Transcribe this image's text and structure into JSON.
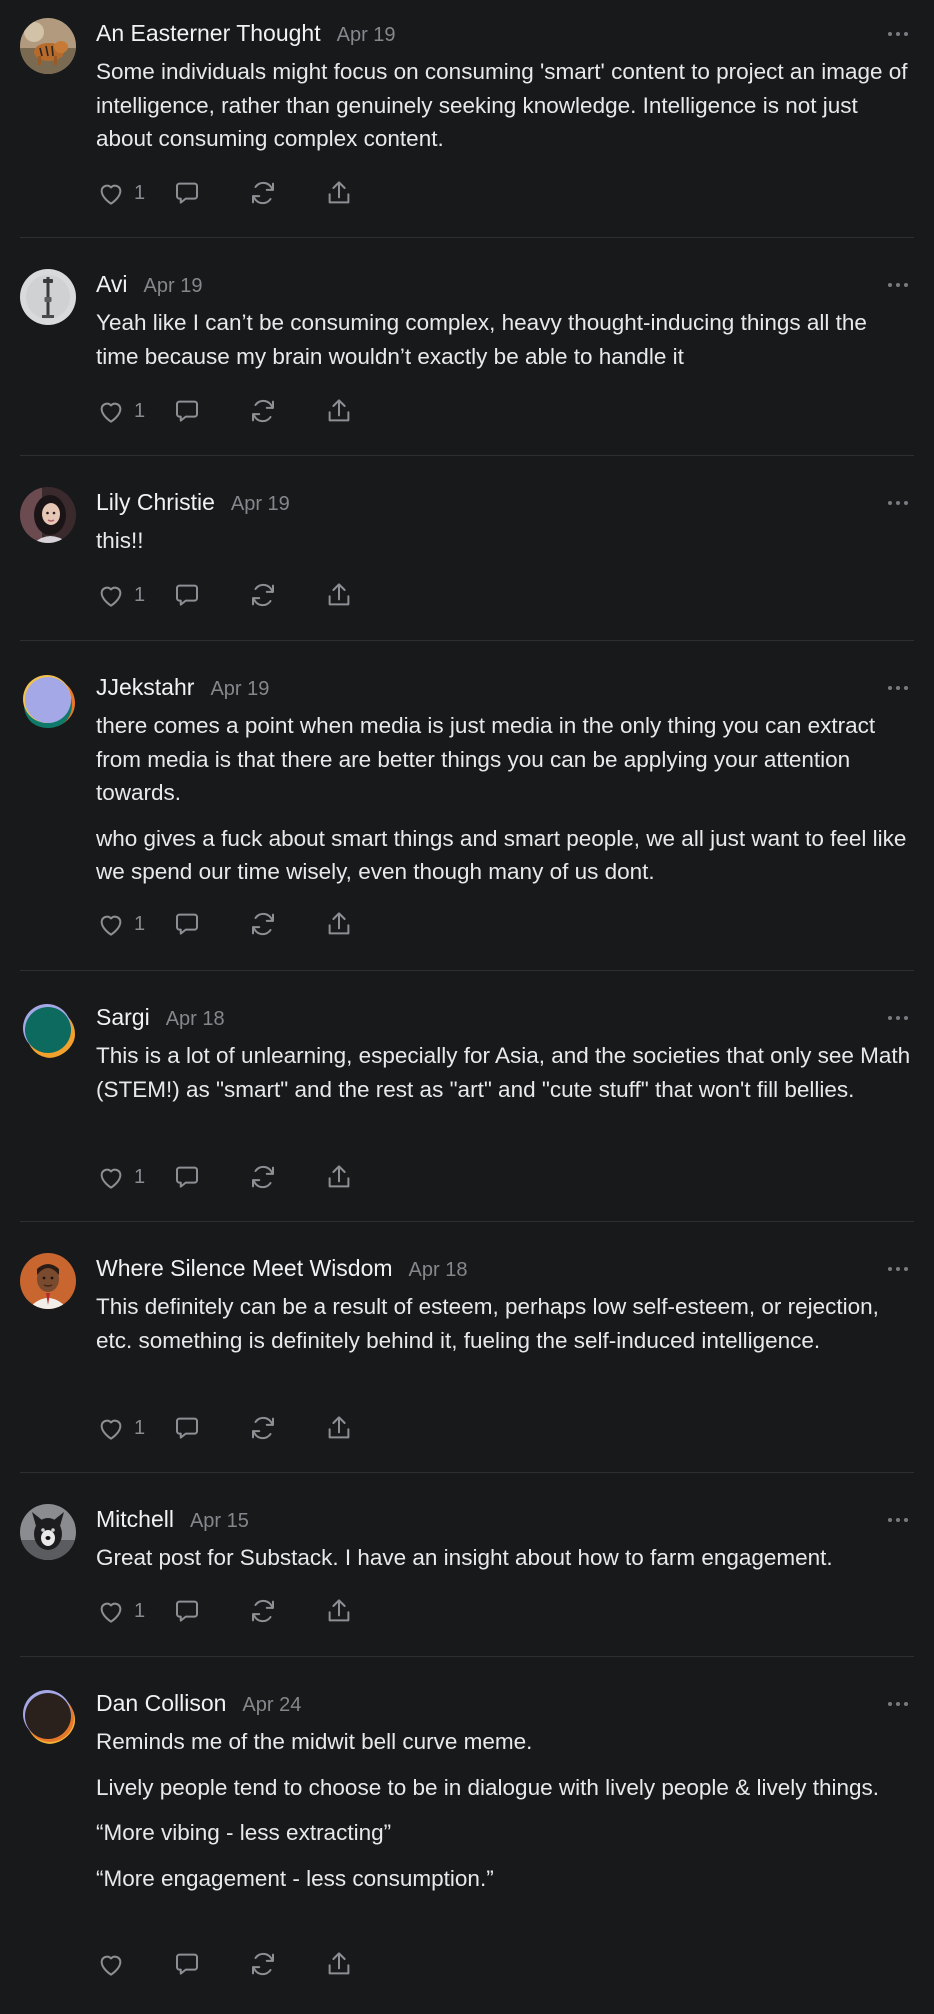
{
  "comments": [
    {
      "author": "An Easterner Thought",
      "date": "Apr 19",
      "paragraphs": [
        "Some individuals might focus on consuming 'smart' content to project an image of intelligence, rather than genuinely seeking knowledge. Intelligence is not just about consuming complex content."
      ],
      "likes": "1",
      "avatar": "photo-tiger"
    },
    {
      "author": "Avi",
      "date": "Apr 19",
      "paragraphs": [
        "Yeah like I can’t be consuming complex, heavy thought-inducing things all the time because my brain wouldn’t exactly be able to handle it"
      ],
      "likes": "1",
      "avatar": "photo-pole"
    },
    {
      "author": "Lily Christie",
      "date": "Apr 19",
      "paragraphs": [
        "this!!"
      ],
      "likes": "1",
      "avatar": "photo-person"
    },
    {
      "author": "JJekstahr",
      "date": "Apr 19",
      "paragraphs": [
        "there comes a point when media is just media in the only thing you can extract from media is that there are better things you can be applying your attention towards.",
        "who gives a fuck about smart things and smart people, we all just want to feel like we spend our time wisely, even though many of us dont."
      ],
      "likes": "1",
      "avatar": "default-lavender"
    },
    {
      "author": "Sargi",
      "date": "Apr 18",
      "paragraphs": [
        "This is a lot of unlearning, especially for Asia, and the societies that only see Math (STEM!) as \"smart\" and the rest as \"art\" and \"cute stuff\" that won't fill bellies."
      ],
      "likes": "1",
      "avatar": "default-teal"
    },
    {
      "author": "Where Silence Meet Wisdom",
      "date": "Apr 18",
      "paragraphs": [
        "This definitely can be a result of esteem, perhaps low self-esteem, or rejection, etc. something is definitely behind it, fueling the self-induced intelligence."
      ],
      "likes": "1",
      "avatar": "illustration-man"
    },
    {
      "author": "Mitchell",
      "date": "Apr 15",
      "paragraphs": [
        "Great post for Substack. I have an insight about how to farm engagement."
      ],
      "likes": "1",
      "avatar": "photo-dog"
    },
    {
      "author": "Dan Collison",
      "date": "Apr 24",
      "paragraphs": [
        "Reminds me of the midwit bell curve meme.",
        "Lively people tend to choose to be in dialogue with lively people & lively things.",
        "“More vibing - less extracting”",
        "“More engagement - less consumption.”"
      ],
      "likes": "",
      "avatar": "default-dark"
    }
  ],
  "icons": {
    "like": "heart-icon",
    "reply": "speech-bubble-icon",
    "restack": "restack-arrows-icon",
    "share": "share-upload-icon",
    "more": "more-dots-icon"
  },
  "colors": {
    "background": "#18191b",
    "text": "#e9e9ea",
    "muted": "#86878c",
    "divider": "#2e2f32"
  }
}
